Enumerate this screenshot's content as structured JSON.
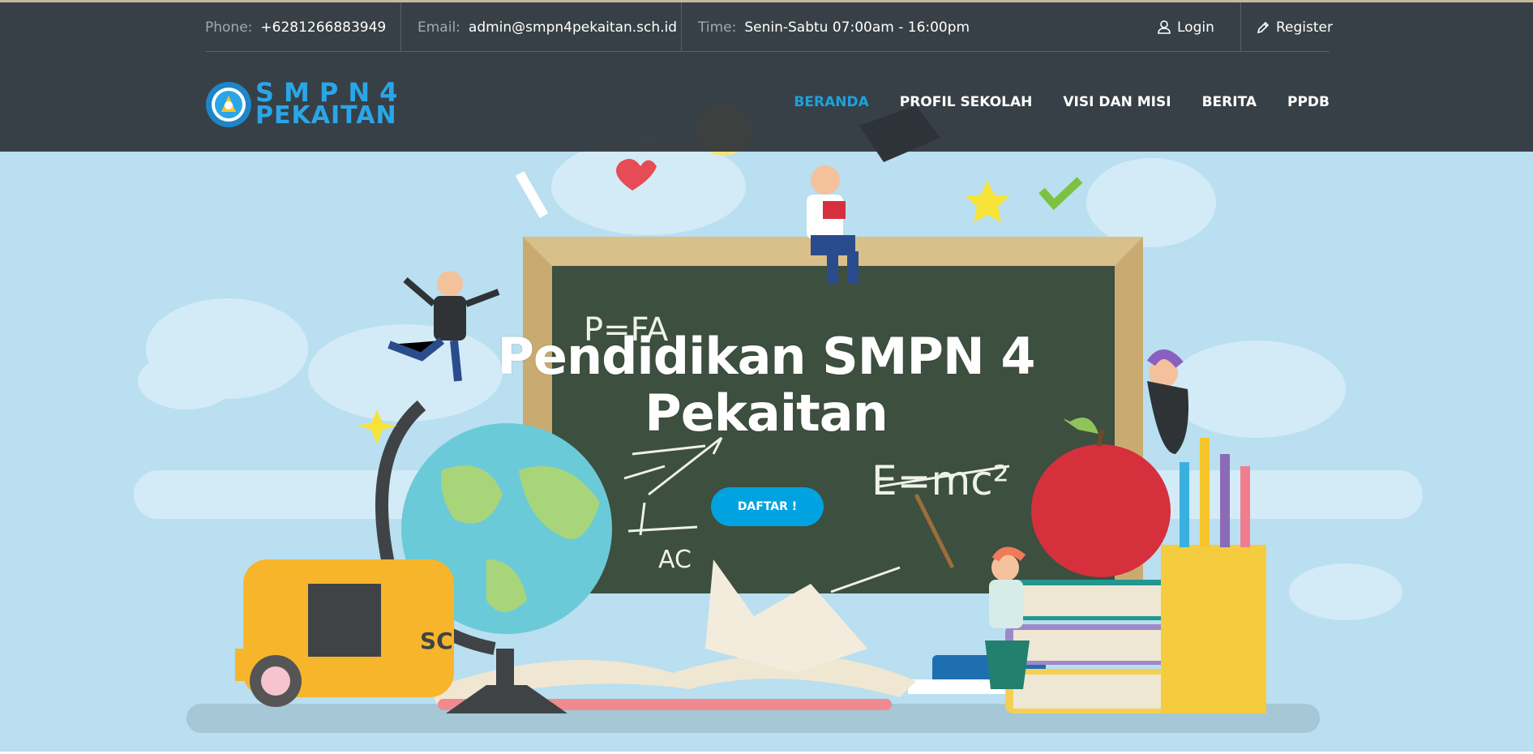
{
  "topbar": {
    "phone_label": "Phone:",
    "phone_value": "+6281266883949",
    "email_label": "Email:",
    "email_value": "admin@smpn4pekaitan.sch.id",
    "time_label": "Time:",
    "time_value": "Senin-Sabtu 07:00am - 16:00pm",
    "login_label": "Login",
    "register_label": "Register"
  },
  "logo": {
    "line1": "SMPN4",
    "line2": "PEKAITAN"
  },
  "nav": {
    "items": [
      {
        "label": "BERANDA",
        "active": true
      },
      {
        "label": "PROFIL SEKOLAH",
        "active": false
      },
      {
        "label": "VISI DAN MISI",
        "active": false
      },
      {
        "label": "BERITA",
        "active": false
      },
      {
        "label": "PPDB",
        "active": false
      }
    ]
  },
  "hero": {
    "title_line1": "Pendidikan SMPN 4",
    "title_line2": "Pekaitan",
    "cta_label": "DAFTAR !",
    "board_text": [
      "P=FA",
      "E=mc²",
      "AC"
    ]
  },
  "colors": {
    "header_bg": "#2d3439",
    "accent": "#1aa3de",
    "cta_bg": "#00a3e0",
    "sky": "#b9dff0",
    "chalkboard": "#3d4f3f"
  }
}
